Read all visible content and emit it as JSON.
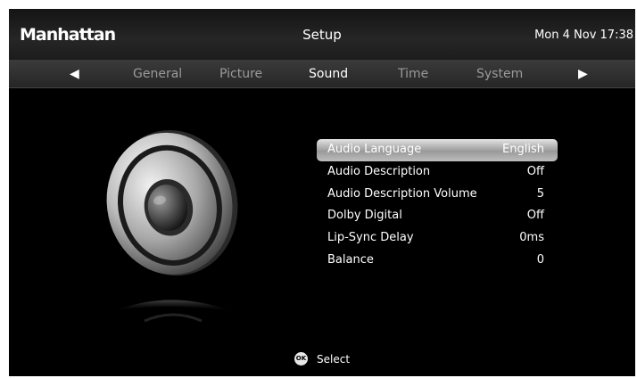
{
  "header": {
    "brand": "Manhattan",
    "title": "Setup",
    "datetime": "Mon 4 Nov 17:38"
  },
  "tabs": {
    "prev_icon": "triangle-left",
    "next_icon": "triangle-right",
    "items": [
      "General",
      "Picture",
      "Sound",
      "Time",
      "System"
    ],
    "active": "Sound"
  },
  "menu": {
    "selected_index": 0,
    "items": [
      {
        "label": "Audio Language",
        "value": "English"
      },
      {
        "label": "Audio Description",
        "value": "Off"
      },
      {
        "label": "Audio Description Volume",
        "value": "5"
      },
      {
        "label": "Dolby Digital",
        "value": "Off"
      },
      {
        "label": "Lip-Sync Delay",
        "value": "0ms"
      },
      {
        "label": "Balance",
        "value": "0"
      }
    ]
  },
  "footer": {
    "ok_button": "OK",
    "action": "Select"
  },
  "colors": {
    "background": "#000000",
    "highlight": "#c8c8c8",
    "text": "#ffffff",
    "inactive_tab": "#9a9a9a"
  }
}
